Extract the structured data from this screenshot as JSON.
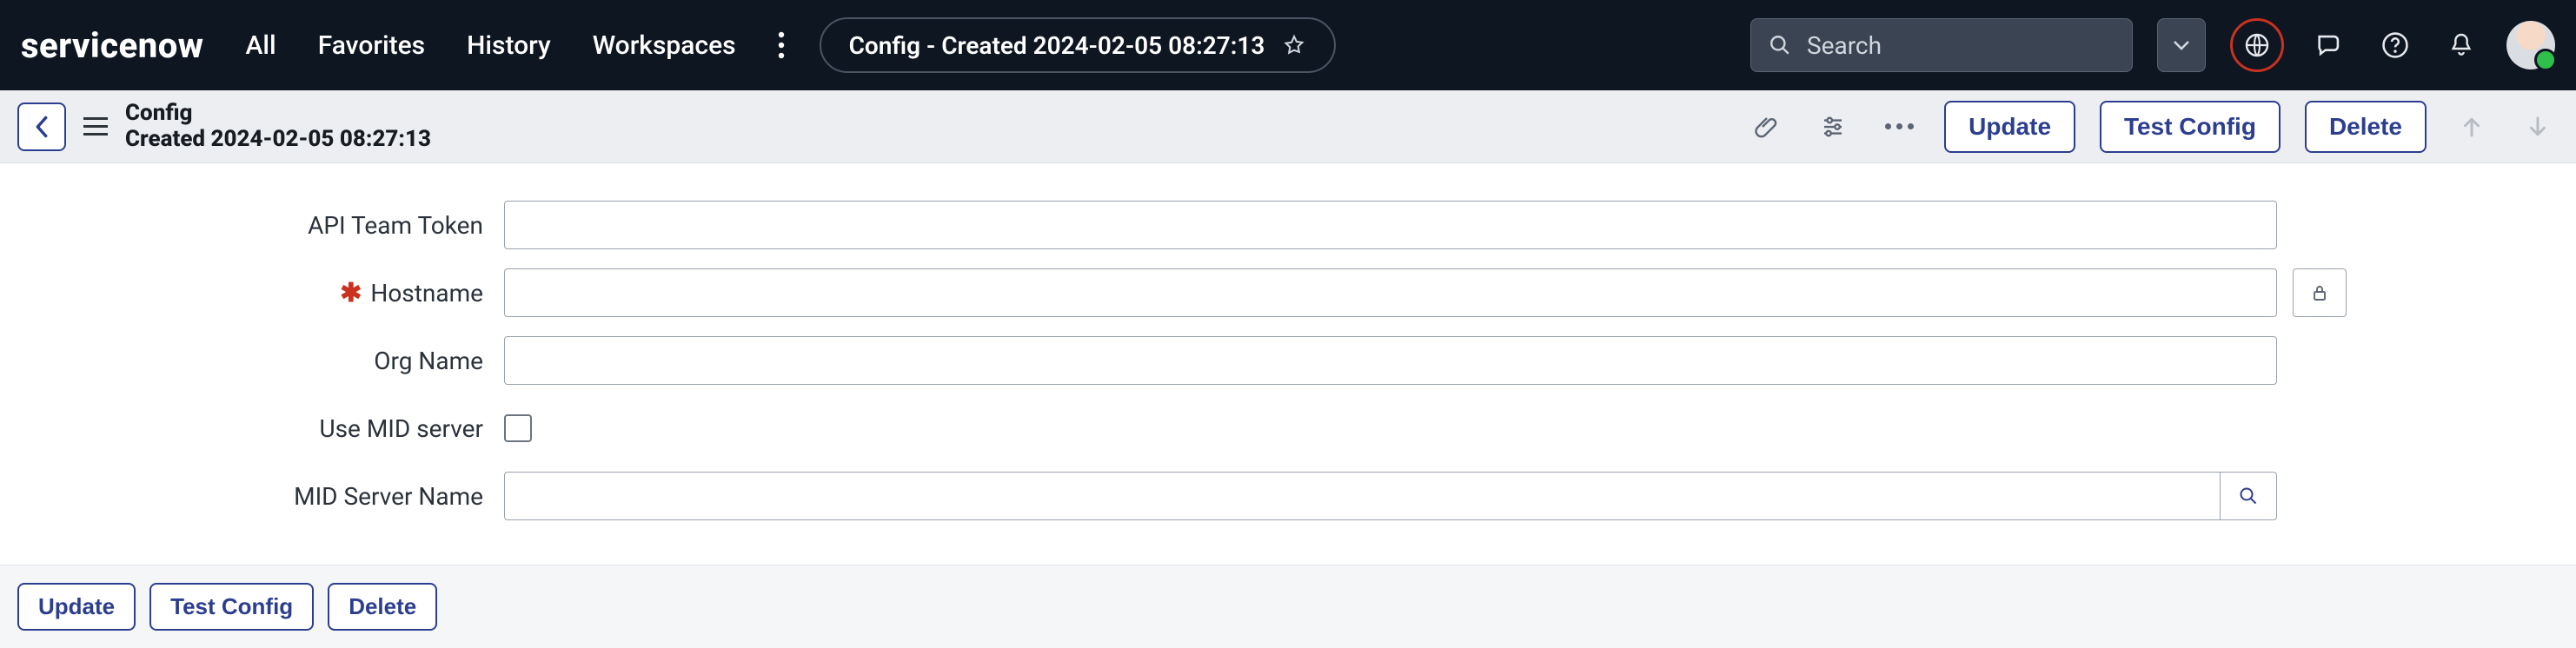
{
  "globalnav": {
    "logo_text": "servicenow",
    "links": {
      "all": "All",
      "favorites": "Favorites",
      "history": "History",
      "workspaces": "Workspaces"
    },
    "breadcrumb": "Config - Created 2024-02-05 08:27:13",
    "search_placeholder": "Search"
  },
  "recordbar": {
    "title": "Config",
    "subtitle": "Created 2024-02-05 08:27:13",
    "buttons": {
      "update": "Update",
      "test": "Test Config",
      "delete": "Delete"
    }
  },
  "form": {
    "labels": {
      "api_token": "API Team Token",
      "hostname": "Hostname",
      "org_name": "Org Name",
      "use_mid": "Use MID server",
      "mid_name": "MID Server Name"
    },
    "values": {
      "api_token": "",
      "hostname": "",
      "org_name": "",
      "use_mid": false,
      "mid_name": ""
    }
  },
  "footer": {
    "buttons": {
      "update": "Update",
      "test": "Test Config",
      "delete": "Delete"
    }
  }
}
